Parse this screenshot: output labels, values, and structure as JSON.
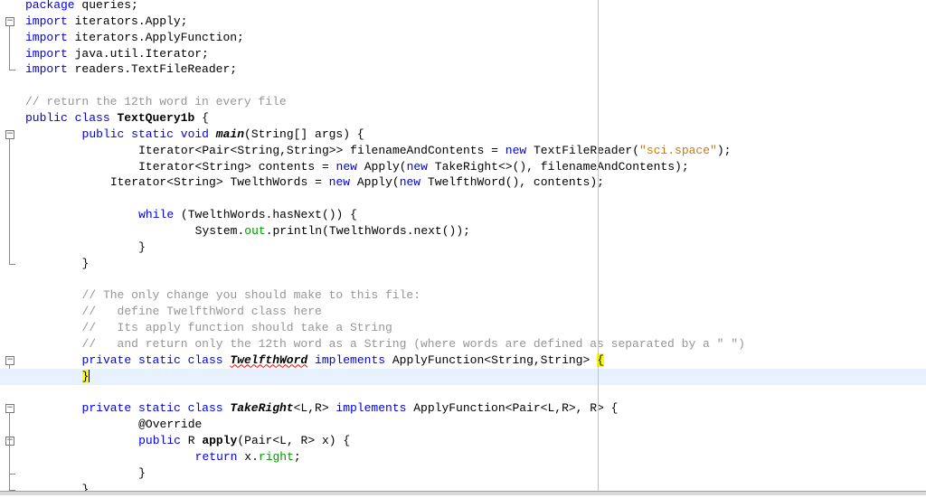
{
  "editor": {
    "lines": [
      {
        "indent": 0,
        "fold": "",
        "tokens": [
          {
            "t": "package",
            "c": "kw"
          },
          {
            "t": " queries;",
            "c": ""
          }
        ]
      },
      {
        "indent": 0,
        "fold": "open",
        "tokens": [
          {
            "t": "import",
            "c": "kw"
          },
          {
            "t": " iterators.Apply;",
            "c": ""
          }
        ]
      },
      {
        "indent": 0,
        "fold": "",
        "tokens": [
          {
            "t": "import",
            "c": "kw"
          },
          {
            "t": " iterators.ApplyFunction;",
            "c": ""
          }
        ]
      },
      {
        "indent": 0,
        "fold": "",
        "tokens": [
          {
            "t": "import",
            "c": "kw"
          },
          {
            "t": " java.util.Iterator;",
            "c": ""
          }
        ]
      },
      {
        "indent": 0,
        "fold": "end",
        "tokens": [
          {
            "t": "import",
            "c": "kw"
          },
          {
            "t": " readers.TextFileReader;",
            "c": ""
          }
        ]
      },
      {
        "indent": 0,
        "fold": "",
        "tokens": []
      },
      {
        "indent": 0,
        "fold": "",
        "tokens": [
          {
            "t": "// return the 12th word in every file",
            "c": "cm"
          }
        ]
      },
      {
        "indent": 0,
        "fold": "",
        "tokens": [
          {
            "t": "public class",
            "c": "kw"
          },
          {
            "t": " ",
            "c": ""
          },
          {
            "t": "TextQuery1b",
            "c": "bd"
          },
          {
            "t": " {",
            "c": ""
          }
        ]
      },
      {
        "indent": 8,
        "fold": "open",
        "tokens": [
          {
            "t": "public static void",
            "c": "kw"
          },
          {
            "t": " ",
            "c": ""
          },
          {
            "t": "main",
            "c": "bi"
          },
          {
            "t": "(String[] args) {",
            "c": ""
          }
        ]
      },
      {
        "indent": 16,
        "fold": "",
        "tokens": [
          {
            "t": "Iterator<Pair<String,String>> filenameAndContents = ",
            "c": ""
          },
          {
            "t": "new",
            "c": "kw"
          },
          {
            "t": " TextFileReader(",
            "c": ""
          },
          {
            "t": "\"sci.space\"",
            "c": "st"
          },
          {
            "t": ");",
            "c": ""
          }
        ]
      },
      {
        "indent": 16,
        "fold": "",
        "tokens": [
          {
            "t": "Iterator<String> contents = ",
            "c": ""
          },
          {
            "t": "new",
            "c": "kw"
          },
          {
            "t": " Apply(",
            "c": ""
          },
          {
            "t": "new",
            "c": "kw"
          },
          {
            "t": " TakeRight<>(), filenameAndContents);",
            "c": ""
          }
        ]
      },
      {
        "indent": 12,
        "fold": "",
        "tokens": [
          {
            "t": "Iterator<String> TwelthWords = ",
            "c": ""
          },
          {
            "t": "new",
            "c": "kw"
          },
          {
            "t": " Apply(",
            "c": ""
          },
          {
            "t": "new",
            "c": "kw"
          },
          {
            "t": " TwelfthWord(), contents);",
            "c": ""
          }
        ]
      },
      {
        "indent": 0,
        "fold": "",
        "tokens": []
      },
      {
        "indent": 16,
        "fold": "",
        "tokens": [
          {
            "t": "while",
            "c": "kw"
          },
          {
            "t": " (TwelthWords.hasNext()) {",
            "c": ""
          }
        ]
      },
      {
        "indent": 24,
        "fold": "",
        "tokens": [
          {
            "t": "System.",
            "c": ""
          },
          {
            "t": "out",
            "c": "fd"
          },
          {
            "t": ".println(TwelthWords.next());",
            "c": ""
          }
        ]
      },
      {
        "indent": 16,
        "fold": "",
        "tokens": [
          {
            "t": "}",
            "c": ""
          }
        ]
      },
      {
        "indent": 8,
        "fold": "end",
        "tokens": [
          {
            "t": "}",
            "c": ""
          }
        ]
      },
      {
        "indent": 0,
        "fold": "",
        "tokens": []
      },
      {
        "indent": 8,
        "fold": "",
        "tokens": [
          {
            "t": "// The only change you should make to this file:",
            "c": "cm"
          }
        ]
      },
      {
        "indent": 8,
        "fold": "",
        "tokens": [
          {
            "t": "//   define TwelfthWord class here",
            "c": "cm"
          }
        ]
      },
      {
        "indent": 8,
        "fold": "",
        "tokens": [
          {
            "t": "//   Its apply function should take a String",
            "c": "cm"
          }
        ]
      },
      {
        "indent": 8,
        "fold": "",
        "tokens": [
          {
            "t": "//   and return only the 12th word as a String (where words are defined as separated by a \" \")",
            "c": "cm"
          }
        ]
      },
      {
        "indent": 8,
        "fold": "open",
        "tokens": [
          {
            "t": "private static class",
            "c": "kw"
          },
          {
            "t": " ",
            "c": ""
          },
          {
            "t": "TwelfthWord",
            "c": "bi err"
          },
          {
            "t": " ",
            "c": ""
          },
          {
            "t": "implements",
            "c": "kw"
          },
          {
            "t": " ApplyFunction<String,String> ",
            "c": ""
          },
          {
            "t": "{",
            "c": "hl"
          }
        ]
      },
      {
        "indent": 8,
        "fold": "end",
        "current": true,
        "tokens": [
          {
            "t": "}",
            "c": "hl"
          }
        ]
      },
      {
        "indent": 0,
        "fold": "",
        "tokens": []
      },
      {
        "indent": 8,
        "fold": "open",
        "tokens": [
          {
            "t": "private static class",
            "c": "kw"
          },
          {
            "t": " ",
            "c": ""
          },
          {
            "t": "TakeRight",
            "c": "bi"
          },
          {
            "t": "<L,R> ",
            "c": ""
          },
          {
            "t": "implements",
            "c": "kw"
          },
          {
            "t": " ApplyFunction<Pair<L,R>, R> {",
            "c": ""
          }
        ]
      },
      {
        "indent": 16,
        "fold": "",
        "tokens": [
          {
            "t": "@Override",
            "c": ""
          }
        ]
      },
      {
        "indent": 16,
        "fold": "open",
        "tokens": [
          {
            "t": "public",
            "c": "kw"
          },
          {
            "t": " R ",
            "c": ""
          },
          {
            "t": "apply",
            "c": "bd"
          },
          {
            "t": "(Pair<L, R> x) {",
            "c": ""
          }
        ]
      },
      {
        "indent": 24,
        "fold": "",
        "tokens": [
          {
            "t": "return",
            "c": "kw"
          },
          {
            "t": " x.",
            "c": ""
          },
          {
            "t": "right",
            "c": "fd"
          },
          {
            "t": ";",
            "c": ""
          }
        ]
      },
      {
        "indent": 16,
        "fold": "end",
        "tokens": [
          {
            "t": "}",
            "c": ""
          }
        ]
      },
      {
        "indent": 8,
        "fold": "end",
        "tokens": [
          {
            "t": "}",
            "c": ""
          }
        ]
      }
    ]
  }
}
